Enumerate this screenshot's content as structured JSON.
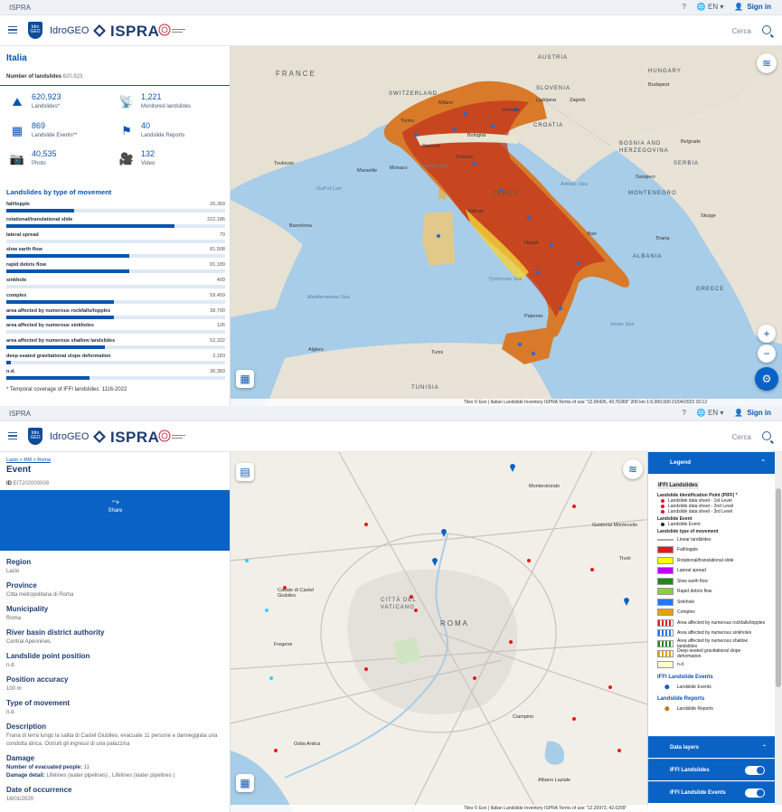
{
  "topbar": {
    "brand": "ISPRA",
    "lang": "EN",
    "signin": "Sign in"
  },
  "header": {
    "app_name": "IdroGEO",
    "logo_mark": "Idro GEO",
    "org": "ISPRA",
    "search_label": "Cerca"
  },
  "overview": {
    "title": "Italia",
    "count_label": "Number of landslides",
    "count_value": "620,923",
    "stats": [
      {
        "value": "620,923",
        "label": "Landslides*",
        "icon": "landslide-icon"
      },
      {
        "value": "1,221",
        "label": "Monitored landslides",
        "icon": "monitor-icon"
      },
      {
        "value": "869",
        "label": "Landslide Events**",
        "icon": "event-icon"
      },
      {
        "value": "40",
        "label": "Landslide Reports",
        "icon": "flag-icon"
      },
      {
        "value": "40,535",
        "label": "Photo",
        "icon": "camera-icon"
      },
      {
        "value": "132",
        "label": "Video",
        "icon": "video-icon"
      }
    ],
    "section_title": "Landslides by type of movement",
    "types": [
      {
        "name": "fall/topple",
        "value": "26,369",
        "fraction": 0.31
      },
      {
        "name": "rotational/translational slide",
        "value": "222,186",
        "fraction": 0.77
      },
      {
        "name": "lateral spread",
        "value": "79",
        "fraction": 0.0
      },
      {
        "name": "slow earth flow",
        "value": "81,508",
        "fraction": 0.56
      },
      {
        "name": "rapid debris flow",
        "value": "81,189",
        "fraction": 0.56
      },
      {
        "name": "sinkhole",
        "value": "409",
        "fraction": 0.0
      },
      {
        "name": "complex",
        "value": "59,459",
        "fraction": 0.49
      },
      {
        "name": "area affected by numerous rockfalls/topples",
        "value": "38,700",
        "fraction": 0.49
      },
      {
        "name": "area affected by numerous sinkholes",
        "value": "126",
        "fraction": 0.0
      },
      {
        "name": "area affected by numerous shallow landslides",
        "value": "52,322",
        "fraction": 0.45
      },
      {
        "name": "deep-seated gravitational slope deformation",
        "value": "2,183",
        "fraction": 0.02
      },
      {
        "name": "n.d.",
        "value": "36,383",
        "fraction": 0.38
      }
    ],
    "note": "* Temporal coverage of IFFI landslides: 1116-2022"
  },
  "map1": {
    "labels": [
      "FRANCE",
      "AUSTRIA",
      "HUNGARY",
      "SLOVENIA",
      "CROATIA",
      "BOSNIA AND HERZEGOVINA",
      "SERBIA",
      "ITALY",
      "GREECE",
      "MONTENEGRO",
      "ALBANIA",
      "TUNISIA",
      "SWITZERLAND"
    ],
    "cities": [
      "Milano",
      "Torino",
      "Venezia",
      "Bologna",
      "Firenze",
      "Monaco",
      "Genova",
      "Marseille",
      "Toulouse",
      "Barcelona",
      "Vatican",
      "Napoli",
      "Bari",
      "Palermo",
      "Algiers",
      "Tunis",
      "Ljubljana",
      "Zagreb",
      "Sarajevo",
      "Belgrade",
      "Budapest",
      "Tirana",
      "Skopje"
    ],
    "seas": [
      "Ligurian Sea",
      "Tyrrhenian Sea",
      "Adriatic Sea",
      "Mediterranean Sea",
      "Ionian Sea",
      "Gulf of Lion"
    ],
    "attribution": "Tiles © Esri | Italian Landslide Inventory ISPRA Terms of use   \"12.00426, 43.76369\"      200 km        1:6,000,000        21/04/2023 15:12"
  },
  "event": {
    "breadcrumb": "Lazio > RM > Roma",
    "title": "Event",
    "id_label": "ID",
    "id_value": "EIT202000008",
    "share": "Share",
    "fields": [
      {
        "k": "Region",
        "v": "Lazio"
      },
      {
        "k": "Province",
        "v": "Citta metropolitana di Roma"
      },
      {
        "k": "Municipality",
        "v": "Roma"
      },
      {
        "k": "River basin district authority",
        "v": "Central Apennines"
      },
      {
        "k": "Landslide point position",
        "v": "n.d."
      },
      {
        "k": "Position accuracy",
        "v": "100 m"
      },
      {
        "k": "Type of movement",
        "v": "n.d."
      },
      {
        "k": "Description",
        "v": "Frana di terra lungo la salita di Castel Giubileo, evacuate 11 persone e danneggiata una condotta idrica. Ostruiti gli ingressi di una palazzina"
      }
    ],
    "damage_title": "Damage",
    "damage_evacuated_label": "Number of evacuated people:",
    "damage_evacuated_value": "11",
    "damage_detail_label": "Damage detail:",
    "damage_detail_value": "Lifelines (water pipelines) , Lifelines (water pipelines )",
    "date_label": "Date of occurrence",
    "date_value": "16/01/2020"
  },
  "map2": {
    "places": [
      "CITTÀ DEL VATICANO",
      "ROMA",
      "Monterotondo",
      "Guidonia Montecelio",
      "Tivoli",
      "Ciampino",
      "Albano Laziale",
      "Ostia Antica",
      "Fregene",
      "Casale di Castel Giubileo"
    ],
    "attribution": "Tiles © Esri | Italian Landslide Inventory ISPRA Terms of use   \"12.20973, 42.0209\""
  },
  "legend": {
    "title": "Legend",
    "section": "IFFI Landslides",
    "pip_title": "Landslide Identification Point (PIFF) *",
    "pip_items": [
      "Landslide data sheet - 1st Level",
      "Landslide data sheet - 2nd Level",
      "Landslide data sheet - 3rd Level"
    ],
    "event_title": "Landslide Event",
    "event_item": "Landslide Event",
    "type_title": "Landslide type of movement",
    "types": [
      {
        "label": "Linear landslides",
        "color": "#ffffff"
      },
      {
        "label": "Fall/topple",
        "color": "#e31a1c"
      },
      {
        "label": "Rotational/translational slide",
        "color": "#ffff00"
      },
      {
        "label": "Lateral spread",
        "color": "#c000ff"
      },
      {
        "label": "Slow earth flow",
        "color": "#1a8a1a"
      },
      {
        "label": "Rapid debris flow",
        "color": "#8ccf3c"
      },
      {
        "label": "Sinkhole",
        "color": "#1f78ff"
      },
      {
        "label": "Complex",
        "color": "#e8a000"
      },
      {
        "label": "Area affected by numerous rockfalls/topples",
        "color": "#e31a1c"
      },
      {
        "label": "Area affected by numerous sinkholes",
        "color": "#1f78ff"
      },
      {
        "label": "Area affected by numerous shallow landslides",
        "color": "#1a8a1a"
      },
      {
        "label": "Deep-seated gravitational slope deformation",
        "color": "#e8a000"
      },
      {
        "label": "n.d.",
        "color": "#ffffcc"
      }
    ],
    "events_title": "IFFI Landslide Events",
    "events_item": "Landslide Events",
    "reports_title": "Landslide Reports",
    "reports_item": "Landslide Reports",
    "data_layers": "Data layers",
    "layers": [
      "IFFI Landslides",
      "IFFI Landslide Events"
    ]
  },
  "colors": {
    "accent": "#0a55b0",
    "band": "#0a62c4"
  }
}
